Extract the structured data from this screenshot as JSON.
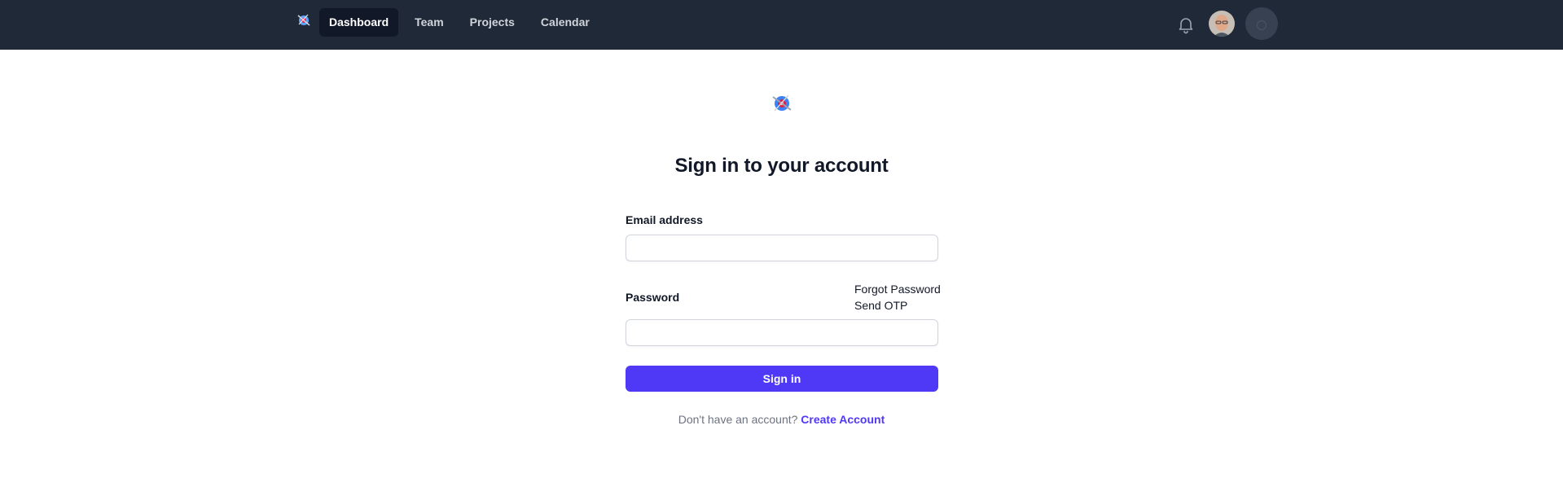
{
  "nav": {
    "logo_icon": "brand-logo-icon",
    "links": [
      {
        "label": "Dashboard",
        "active": true
      },
      {
        "label": "Team",
        "active": false
      },
      {
        "label": "Projects",
        "active": false
      },
      {
        "label": "Calendar",
        "active": false
      }
    ],
    "notification_icon": "bell-icon",
    "avatar_icon": "user-avatar",
    "status_icon": "loading-circle-icon",
    "background_color": "#1f2937",
    "active_color": "#111827"
  },
  "form": {
    "logo_icon": "brand-logo-icon",
    "heading": "Sign in to your account",
    "email_label": "Email address",
    "email_value": "",
    "password_label": "Password",
    "password_value": "",
    "forgot_password": "Forgot Password",
    "send_otp": "Send OTP",
    "submit_label": "Sign in",
    "no_account_text": "Don't have an account?",
    "create_account": "Create Account",
    "accent_color": "#4f39f6"
  }
}
